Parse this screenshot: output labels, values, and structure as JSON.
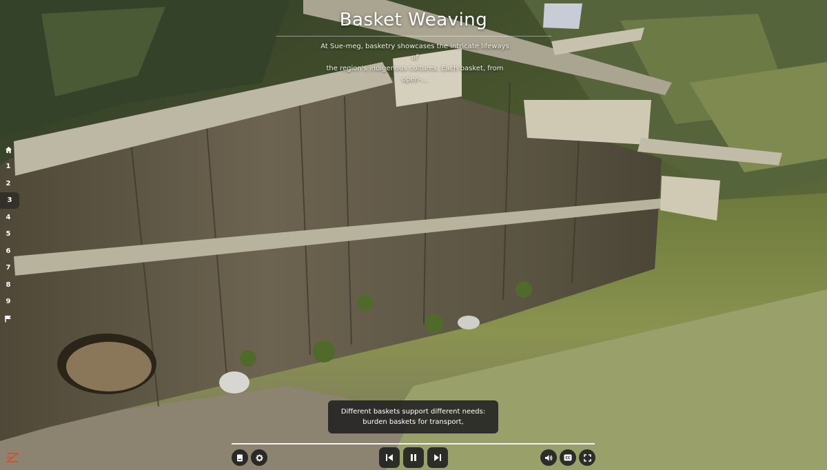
{
  "page": {
    "title": "Basket Weaving",
    "description_line1": "At Sue-meg, basketry showcases the intricate lifeways of",
    "description_line2": "the region's indigenous cultures. Each basket, from open-..."
  },
  "nav": {
    "active_index": 3,
    "items": [
      "1",
      "2",
      "3",
      "4",
      "5",
      "6",
      "7",
      "8",
      "9"
    ]
  },
  "caption": {
    "line1": "Different baskets support different needs:",
    "line2": "burden baskets for transport,"
  },
  "player": {
    "progress_fraction": 1.0,
    "icons": {
      "transcript": "book-icon",
      "settings": "gear-icon",
      "previous": "skip-previous-icon",
      "pause": "pause-icon",
      "next": "skip-next-icon",
      "volume": "volume-icon",
      "captions": "closed-captions-icon",
      "fullscreen": "fullscreen-icon"
    }
  },
  "colors": {
    "accent": "#c9563a",
    "control_bg": "#1c1c1c"
  }
}
